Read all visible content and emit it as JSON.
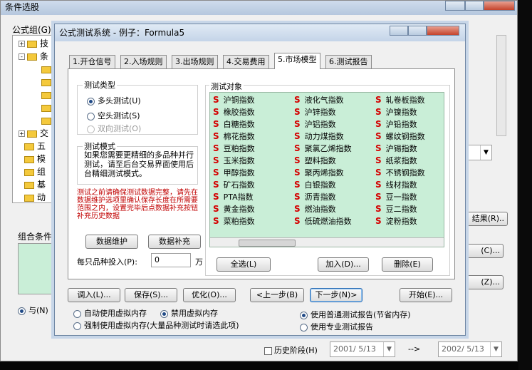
{
  "back_window": {
    "title": "条件选股",
    "formula_group_label": "公式组(G):",
    "tree_items": [
      "技",
      "条",
      "",
      "",
      "",
      "",
      "",
      "",
      "交",
      "五",
      "模",
      "组",
      "基",
      "动"
    ],
    "combo_condition_label": "组合条件",
    "and_radio": "与(N)",
    "result_button": "结果(R)..",
    "btn_c": "(C)...",
    "btn_z": "(Z)...",
    "history_checkbox": "历史阶段(H)",
    "date_from": "2001/ 5/13",
    "date_arrow": "-->",
    "date_to": "2002/ 5/13"
  },
  "dialog": {
    "title": "公式测试系统 - 例子：Formula5",
    "tabs": [
      "1.开仓信号",
      "2.入场规则",
      "3.出场规则",
      "4.交易费用",
      "5.市场模型",
      "6.测试报告"
    ],
    "active_tab": 4,
    "test_type_label": "测试类型",
    "radio_long": "多头测试(U)",
    "radio_short": "空头测试(S)",
    "radio_both": "双向测试(O)",
    "test_mode_label": "测试模式",
    "test_mode_text": "如果您需要更精细的多品种并行测试，请至后台交易界面使用后台精细测试模式。",
    "warning_text": "测试之前请确保测试数据完整，请先在数据维护选项里确认保存长度在所需要范围之内，设置完毕后点数据补充按钮补充历史数据",
    "btn_data_maint": "数据维护",
    "btn_data_supply": "数据补充",
    "invest_label": "每只品种投入(P):",
    "invest_value": "0",
    "invest_unit": "万",
    "objects_label": "测试对象",
    "objects": [
      [
        "沪铜指数",
        "液化气指数",
        "轧卷板指数"
      ],
      [
        "橡胶指数",
        "沪锌指数",
        "沪镍指数"
      ],
      [
        "白糖指数",
        "沪铝指数",
        "沪铅指数"
      ],
      [
        "棉花指数",
        "动力煤指数",
        "螺纹钢指数"
      ],
      [
        "豆粕指数",
        "聚氯乙烯指数",
        "沪锡指数"
      ],
      [
        "玉米指数",
        "塑料指数",
        "纸浆指数"
      ],
      [
        "甲醇指数",
        "聚丙烯指数",
        "不锈钢指数"
      ],
      [
        "矿石指数",
        "白银指数",
        "线材指数"
      ],
      [
        "PTA指数",
        "沥青指数",
        "豆一指数"
      ],
      [
        "黄金指数",
        "燃油指数",
        "豆二指数"
      ],
      [
        "菜粕指数",
        "低硫燃油指数",
        "淀粉指数"
      ]
    ],
    "btn_select_all": "全选(L)",
    "btn_add": "加入(D)...",
    "btn_delete": "删除(E)",
    "btn_import": "调入(L)...",
    "btn_save": "保存(S)...",
    "btn_optimize": "优化(O)...",
    "btn_prev": "<上一步(B)",
    "btn_next": "下一步(N)>",
    "btn_start": "开始(E)...",
    "radio_auto_vm": "自动使用虚拟内存",
    "radio_disable_vm": "禁用虚拟内存",
    "radio_force_vm": "强制使用虚拟内存(大量品种测试时请选此项)",
    "radio_normal_report": "使用普通测试报告(节省内存)",
    "radio_pro_report": "使用专业测试报告"
  }
}
